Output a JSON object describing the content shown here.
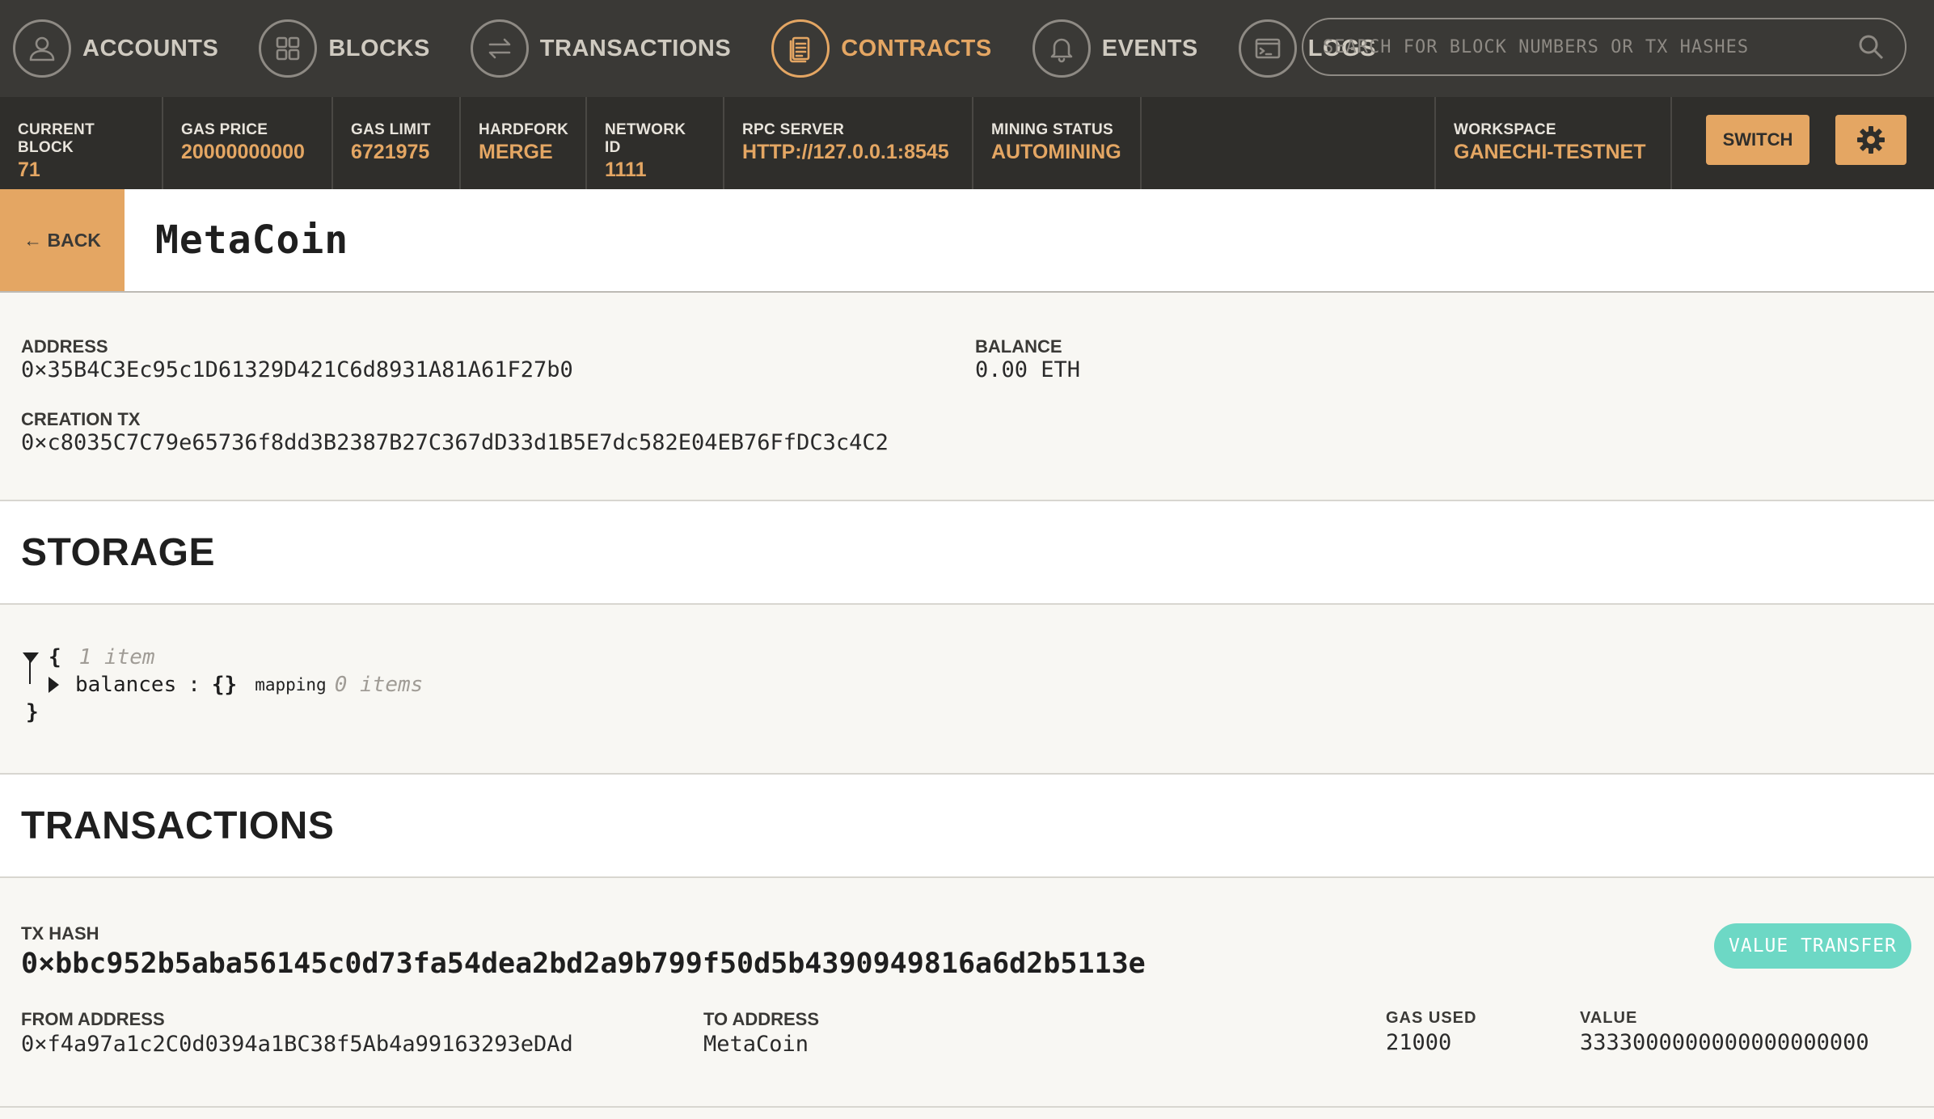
{
  "nav": {
    "items": [
      {
        "label": "ACCOUNTS",
        "icon": "user-icon"
      },
      {
        "label": "BLOCKS",
        "icon": "grid-icon"
      },
      {
        "label": "TRANSACTIONS",
        "icon": "swap-icon"
      },
      {
        "label": "CONTRACTS",
        "icon": "document-icon",
        "active": true
      },
      {
        "label": "EVENTS",
        "icon": "bell-icon"
      },
      {
        "label": "LOGS",
        "icon": "terminal-icon"
      }
    ],
    "search_placeholder": "SEARCH FOR BLOCK NUMBERS OR TX HASHES"
  },
  "stats": {
    "current_block": {
      "label": "CURRENT BLOCK",
      "value": "71"
    },
    "gas_price": {
      "label": "GAS PRICE",
      "value": "20000000000"
    },
    "gas_limit": {
      "label": "GAS LIMIT",
      "value": "6721975"
    },
    "hardfork": {
      "label": "HARDFORK",
      "value": "MERGE"
    },
    "network_id": {
      "label": "NETWORK ID",
      "value": "1111"
    },
    "rpc_server": {
      "label": "RPC SERVER",
      "value": "HTTP://127.0.0.1:8545"
    },
    "mining_status": {
      "label": "MINING STATUS",
      "value": "AUTOMINING"
    },
    "workspace": {
      "label": "WORKSPACE",
      "value": "GANECHI-TESTNET"
    },
    "switch_label": "SWITCH"
  },
  "title_bar": {
    "back_label": "← BACK",
    "title": "MetaCoin"
  },
  "contract": {
    "address_label": "ADDRESS",
    "address": "0×35B4C3Ec95c1D61329D421C6d8931A81A61F27b0",
    "balance_label": "BALANCE",
    "balance": "0.00 ETH",
    "creation_tx_label": "CREATION TX",
    "creation_tx": "0×c8035C7C79e65736f8dd3B2387B27C367dD33d1B5E7dc582E04EB76FfDC3c4C2"
  },
  "storage": {
    "heading": "STORAGE",
    "open_brace": "{",
    "close_brace": "}",
    "item_count": "1 item",
    "entry_key": "balances",
    "entry_sep": ":",
    "entry_value": "{}",
    "entry_type": "mapping",
    "entry_count": "0 items"
  },
  "transactions": {
    "heading": "TRANSACTIONS",
    "items": [
      {
        "hash_label": "TX HASH",
        "hash": "0×bbc952b5aba56145c0d73fa54dea2bd2a9b799f50d5b4390949816a6d2b5113e",
        "badge": "VALUE TRANSFER",
        "from_label": "FROM ADDRESS",
        "from": "0×f4a97a1c2C0d0394a1BC38f5Ab4a99163293eDAd",
        "to_label": "TO ADDRESS",
        "to": "MetaCoin",
        "gas_used_label": "GAS USED",
        "gas_used": "21000",
        "value_label": "VALUE",
        "value": "3333000000000000000000"
      }
    ]
  },
  "colors": {
    "accent": "#e4a663",
    "nav_bg": "#3a3936",
    "badge": "#6dd8c5"
  }
}
